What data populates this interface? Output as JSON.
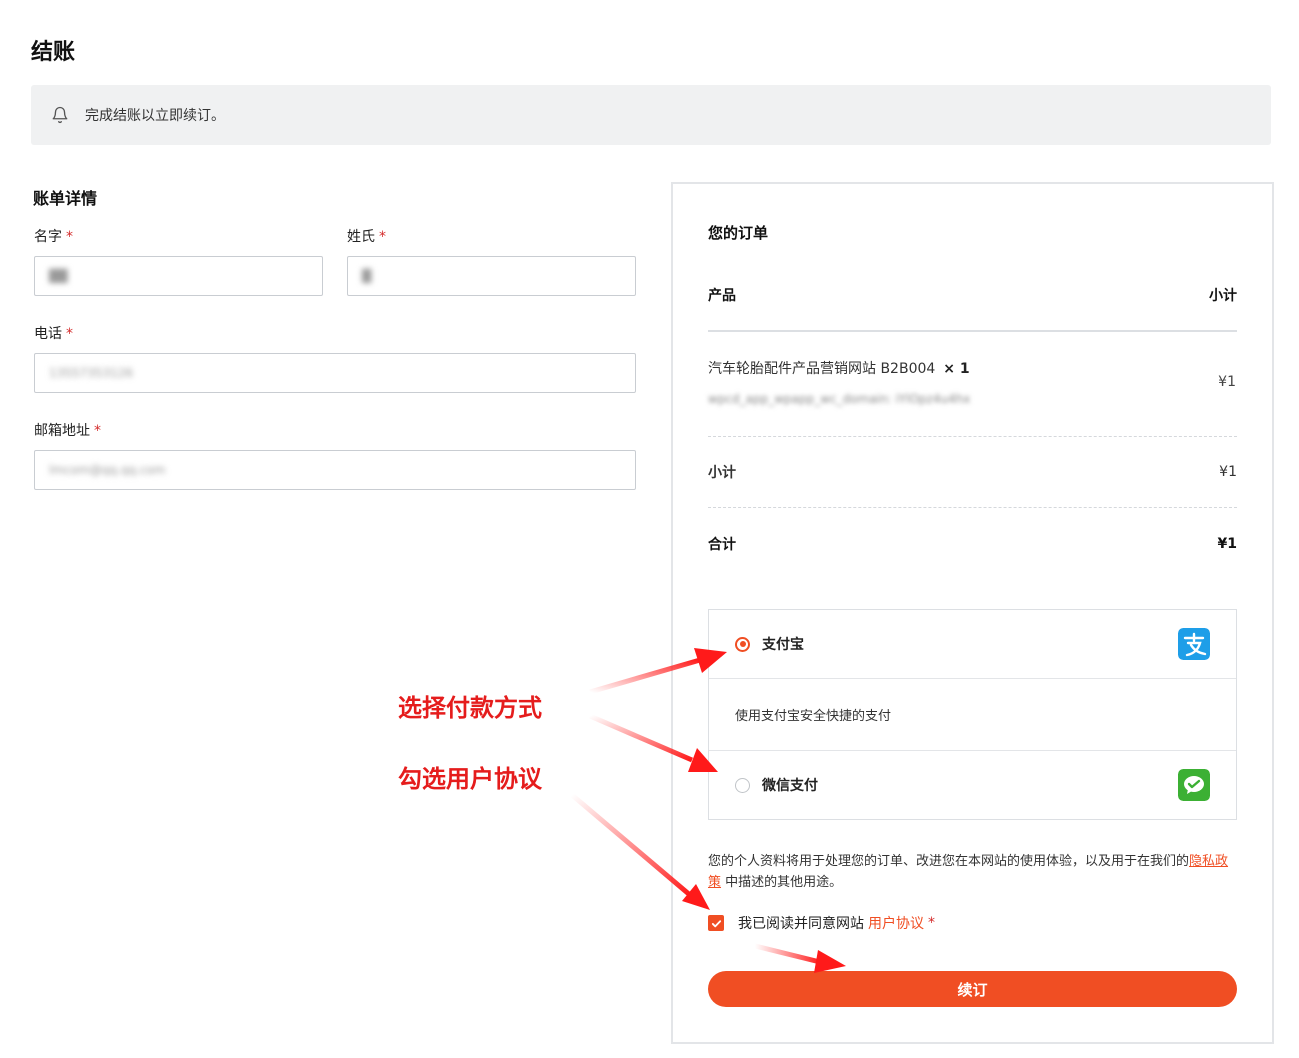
{
  "page": {
    "title": "结账"
  },
  "notice": {
    "icon": "bell-icon",
    "text": "完成结账以立即续订。"
  },
  "billing": {
    "title": "账单详情",
    "first_name": {
      "label": "名字",
      "required": "*",
      "value": "██"
    },
    "last_name": {
      "label": "姓氏",
      "required": "*",
      "value": "█"
    },
    "phone": {
      "label": "电话",
      "required": "*",
      "value": "13557353126"
    },
    "email": {
      "label": "邮箱地址",
      "required": "*",
      "value": "lmcom@qq.qq.com"
    }
  },
  "order": {
    "title": "您的订单",
    "col_product": "产品",
    "col_subtotal": "小计",
    "item": {
      "name": "汽车轮胎配件产品营销网站 B2B004",
      "qty": "× 1",
      "meta": "wpcd_app_wpapp_wc_domain: iYlOpz4u4hx",
      "price": "¥1"
    },
    "subtotal_label": "小计",
    "subtotal_value": "¥1",
    "total_label": "合计",
    "total_value": "¥1"
  },
  "payment": {
    "alipay": {
      "label": "支付宝",
      "icon": "alipay-icon",
      "selected": true,
      "description": "使用支付宝安全快捷的支付"
    },
    "wechat": {
      "label": "微信支付",
      "icon": "wechat-pay-icon",
      "selected": false
    }
  },
  "privacy": {
    "text_before": "您的个人资料将用于处理您的订单、改进您在本网站的使用体验，以及用于在我们的",
    "link": "隐私政策",
    "text_after": " 中描述的其他用途。"
  },
  "agreement": {
    "text": "我已阅读并同意网站",
    "link": "用户协议",
    "required": "*",
    "checked": true
  },
  "submit_label": "续订",
  "annotations": {
    "select_payment": "选择付款方式",
    "check_agreement": "勾选用户协议"
  },
  "colors": {
    "accent": "#f04e23",
    "annotation": "#e51c1c",
    "alipay": "#1e9ee8",
    "wechat": "#3cb034"
  }
}
